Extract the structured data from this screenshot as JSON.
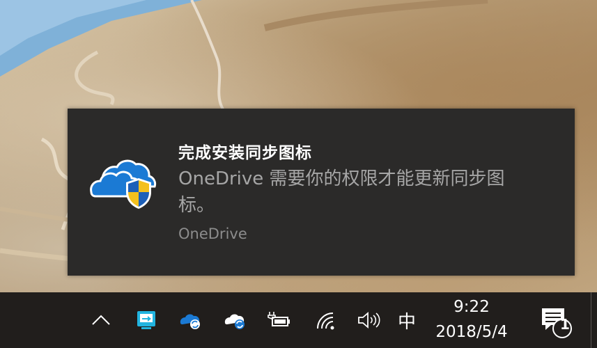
{
  "toast": {
    "title": "完成安装同步图标",
    "body": "OneDrive 需要你的权限才能更新同步图标。",
    "source": "OneDrive",
    "icon": "onedrive-uac-shield-icon"
  },
  "taskbar": {
    "tray_icons": [
      "chevron-up-icon",
      "remote-desktop-icon",
      "onedrive-syncing-icon",
      "onedrive-syncing-white-icon",
      "battery-charging-icon",
      "wifi-icon",
      "volume-icon"
    ],
    "ime": "中",
    "time": "9:22",
    "date": "2018/5/4",
    "notification_count": "1"
  },
  "colors": {
    "toast_bg": "#2b2a29",
    "taskbar_bg": "#211e1c",
    "onedrive_blue": "#1b7ad4",
    "shield_yellow": "#f3c01e"
  }
}
